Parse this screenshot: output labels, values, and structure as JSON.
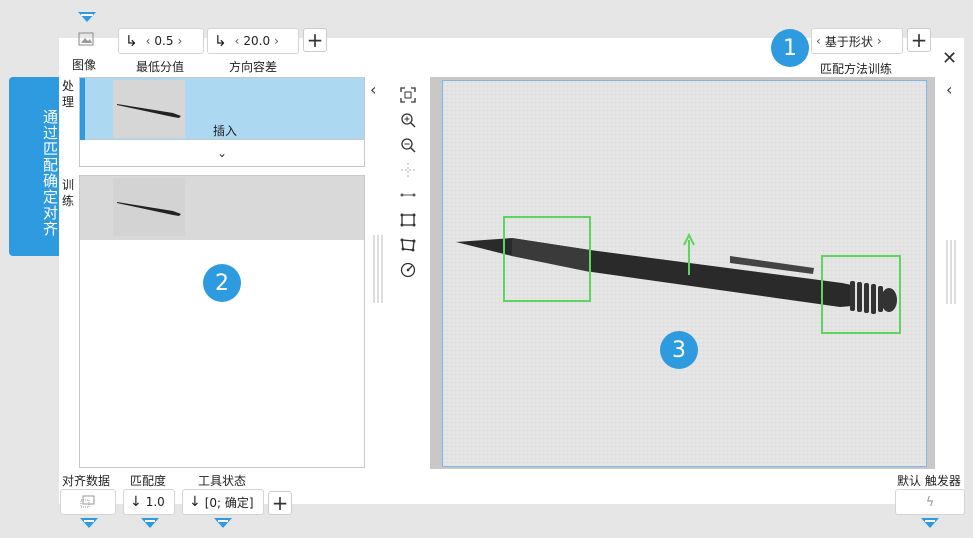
{
  "toolbar": {
    "image_label": "图像",
    "min_score": {
      "label": "最低分值",
      "value": "0.5"
    },
    "direction_tolerance": {
      "label": "方向容差",
      "value": "20.0"
    },
    "method": {
      "label": "匹配方法训练",
      "value": "基于形状"
    }
  },
  "side_tab": {
    "label": "通过匹配确定对齐"
  },
  "left_panel": {
    "process_label": "处理",
    "insert_label": "插入",
    "train_label": "训练"
  },
  "bottom": {
    "align_data_label": "对齐数据",
    "match_label": "匹配度",
    "match_value": "1.0",
    "tool_state_label": "工具状态",
    "tool_state_value": "[0; 确定]",
    "trigger_label": "默认 触发器"
  },
  "badges": [
    "1",
    "2",
    "3"
  ],
  "colors": {
    "accent": "#2e9be0",
    "selected": "#add8f2",
    "roi": "#5fd45f"
  },
  "icons": [
    "image-icon",
    "fit-icon",
    "zoom-in-icon",
    "zoom-out-icon",
    "crosshair-icon",
    "line-icon",
    "rect-icon",
    "polygon-icon",
    "rotate-icon",
    "lightning-icon",
    "close-icon",
    "chevron-left-icon",
    "chevron-down-icon",
    "plus-icon",
    "arrow-down-icon"
  ]
}
